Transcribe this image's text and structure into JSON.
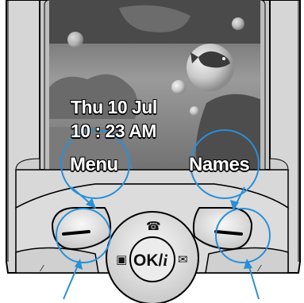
{
  "screen": {
    "date_text": "Thu 10 Jul",
    "time_text": "10 : 23 AM",
    "left_softkey_label": "Menu",
    "right_softkey_label": "Names"
  },
  "keypad": {
    "ok_key_label": "OK/",
    "ok_key_info_glyph": "i",
    "up_key_icon": "house-phone-icon",
    "left_key_icon": "camera-icon",
    "right_key_icon": "envelope-icon"
  },
  "colors": {
    "phone_body": "#d9d9d9",
    "outline": "#000000",
    "highlight_circle": "#2a8fd6",
    "callout_arrow": "#2a8fd6"
  }
}
